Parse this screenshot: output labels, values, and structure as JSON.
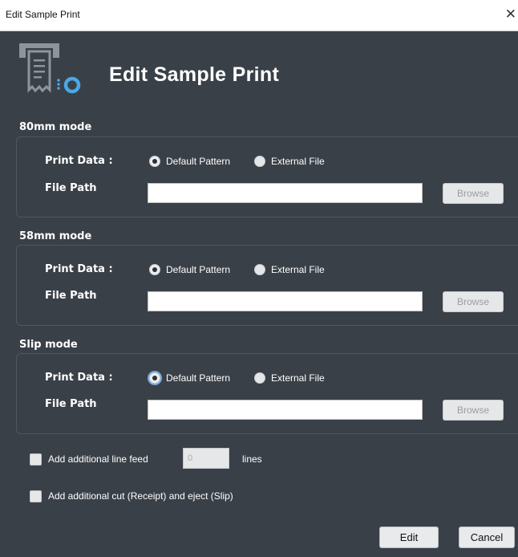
{
  "window": {
    "title": "Edit Sample Print",
    "close_glyph": "✕"
  },
  "header": {
    "title": "Edit Sample Print",
    "icon": "printer-receipt-settings-icon"
  },
  "sections": [
    {
      "label": "80mm mode",
      "print_data_label": "Print Data :",
      "options": [
        "Default Pattern",
        "External File"
      ],
      "selected": "Default Pattern",
      "file_path_label": "File Path",
      "file_path_value": "",
      "browse_label": "Browse"
    },
    {
      "label": "58mm mode",
      "print_data_label": "Print Data :",
      "options": [
        "Default Pattern",
        "External File"
      ],
      "selected": "Default Pattern",
      "file_path_label": "File Path",
      "file_path_value": "",
      "browse_label": "Browse"
    },
    {
      "label": "Slip mode",
      "print_data_label": "Print Data :",
      "options": [
        "Default Pattern",
        "External File"
      ],
      "selected": "Default Pattern",
      "file_path_label": "File Path",
      "file_path_value": "",
      "browse_label": "Browse"
    }
  ],
  "extras": {
    "line_feed_label": "Add additional line feed",
    "line_feed_checked": false,
    "line_feed_value": "0",
    "line_feed_unit": "lines",
    "cut_label": "Add additional cut (Receipt) and eject (Slip)",
    "cut_checked": false
  },
  "buttons": {
    "edit": "Edit",
    "cancel": "Cancel"
  },
  "colors": {
    "background": "#3a4048",
    "text": "#ffffff",
    "group_border": "#50575f",
    "focus_ring": "#7aa8d8"
  }
}
